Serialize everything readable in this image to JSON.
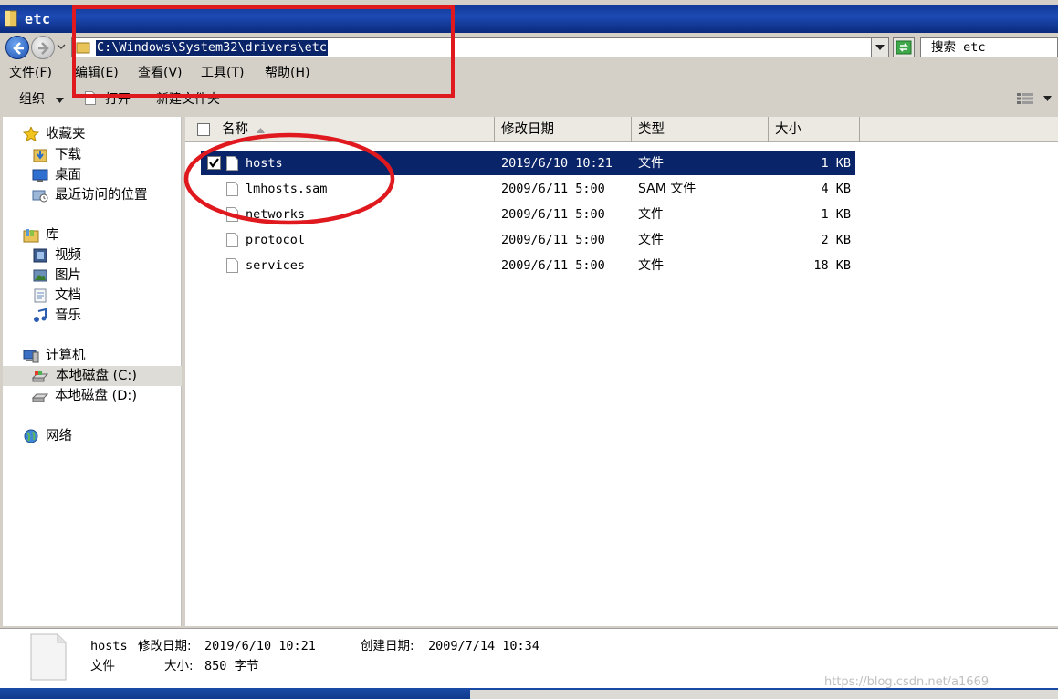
{
  "window": {
    "title": "etc"
  },
  "address_bar": {
    "path": "C:\\Windows\\System32\\drivers\\etc",
    "search_placeholder": "搜索 etc"
  },
  "menu": {
    "items": [
      "文件(F)",
      "编辑(E)",
      "查看(V)",
      "工具(T)",
      "帮助(H)"
    ]
  },
  "toolbar": {
    "organize": "组织",
    "open": "打开",
    "new_folder": "新建文件夹"
  },
  "nav": {
    "favorites": "收藏夹",
    "downloads": "下载",
    "desktop": "桌面",
    "recent": "最近访问的位置",
    "libraries": "库",
    "videos": "视频",
    "pictures": "图片",
    "documents": "文档",
    "music": "音乐",
    "computer": "计算机",
    "drive_c": "本地磁盘 (C:)",
    "drive_d": "本地磁盘 (D:)",
    "network": "网络"
  },
  "columns": {
    "name": "名称",
    "date": "修改日期",
    "type": "类型",
    "size": "大小"
  },
  "files": [
    {
      "name": "hosts",
      "date": "2019/6/10 10:21",
      "type": "文件",
      "size": "1 KB",
      "selected": true
    },
    {
      "name": "lmhosts.sam",
      "date": "2009/6/11 5:00",
      "type": "SAM 文件",
      "size": "4 KB"
    },
    {
      "name": "networks",
      "date": "2009/6/11 5:00",
      "type": "文件",
      "size": "1 KB"
    },
    {
      "name": "protocol",
      "date": "2009/6/11 5:00",
      "type": "文件",
      "size": "2 KB"
    },
    {
      "name": "services",
      "date": "2009/6/11 5:00",
      "type": "文件",
      "size": "18 KB"
    }
  ],
  "details": {
    "name": "hosts",
    "modified_label": "修改日期:",
    "modified": "2019/6/10 10:21",
    "created_label": "创建日期:",
    "created": "2009/7/14 10:34",
    "type": "文件",
    "size_label": "大小:",
    "size": "850 字节"
  },
  "watermark": "https://blog.csdn.net/a1669"
}
